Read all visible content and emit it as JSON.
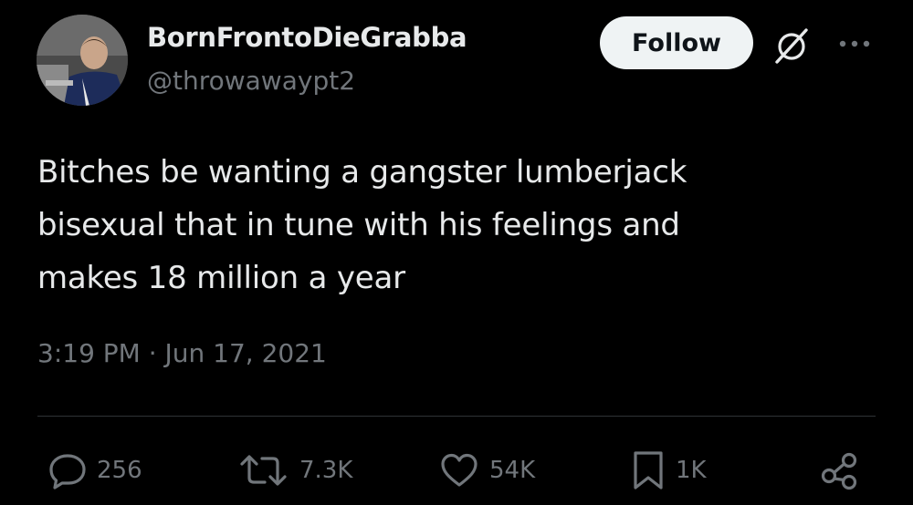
{
  "author": {
    "display_name": "BornFrontoDieGrabba",
    "handle": "@throwawaypt2",
    "avatar_icon": "profile-photo"
  },
  "header": {
    "follow_label": "Follow",
    "grok_icon": "grok-icon",
    "more_icon": "more-dots-icon"
  },
  "tweet": {
    "lines": [
      "Bitches be wanting a gangster lumberjack",
      "bisexual that in tune with his feelings and",
      "makes 18 million a year"
    ],
    "timestamp": "3:19 PM · Jun 17, 2021"
  },
  "actions": {
    "replies": "256",
    "reposts": "7.3K",
    "likes": "54K",
    "bookmarks": "1K",
    "share_icon": "share-icon"
  },
  "colors": {
    "background": "#000000",
    "text_primary": "#e7e9ea",
    "text_secondary": "#71767b",
    "divider": "#2f3336",
    "follow_bg": "#eff3f4"
  }
}
